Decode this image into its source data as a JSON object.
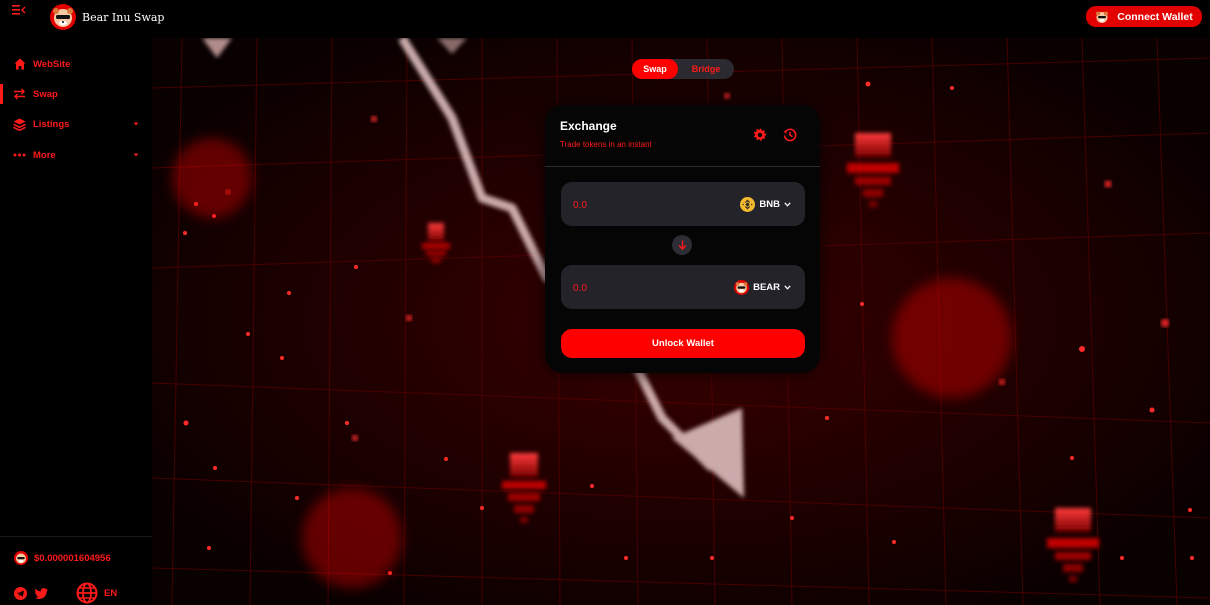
{
  "brand": {
    "name": "Bear Inu Swap"
  },
  "header": {
    "connect_label": "Connect Wallet"
  },
  "sidebar": {
    "items": [
      {
        "label": "WebSite",
        "icon": "home-icon"
      },
      {
        "label": "Swap",
        "icon": "swap-arrows-icon",
        "active": true
      },
      {
        "label": "Listings",
        "icon": "layers-icon",
        "has_submenu": true
      },
      {
        "label": "More",
        "icon": "dots-icon",
        "has_submenu": true
      }
    ],
    "token_price": "$0.000001604956",
    "language": "EN"
  },
  "tabs": [
    {
      "label": "Swap",
      "active": true
    },
    {
      "label": "Bridge",
      "active": false
    }
  ],
  "exchange": {
    "title": "Exchange",
    "subtitle": "Trade tokens in an instant",
    "from": {
      "placeholder": "0.0",
      "token": "BNB"
    },
    "to": {
      "placeholder": "0.0",
      "token": "BEAR"
    },
    "unlock_label": "Unlock Wallet"
  },
  "colors": {
    "accent": "#ff0000",
    "accent_text": "#ff1a1a",
    "card_bg": "#050505",
    "input_bg": "#232329",
    "page_bg": "#000000",
    "bnb": "#f3ba2f"
  }
}
